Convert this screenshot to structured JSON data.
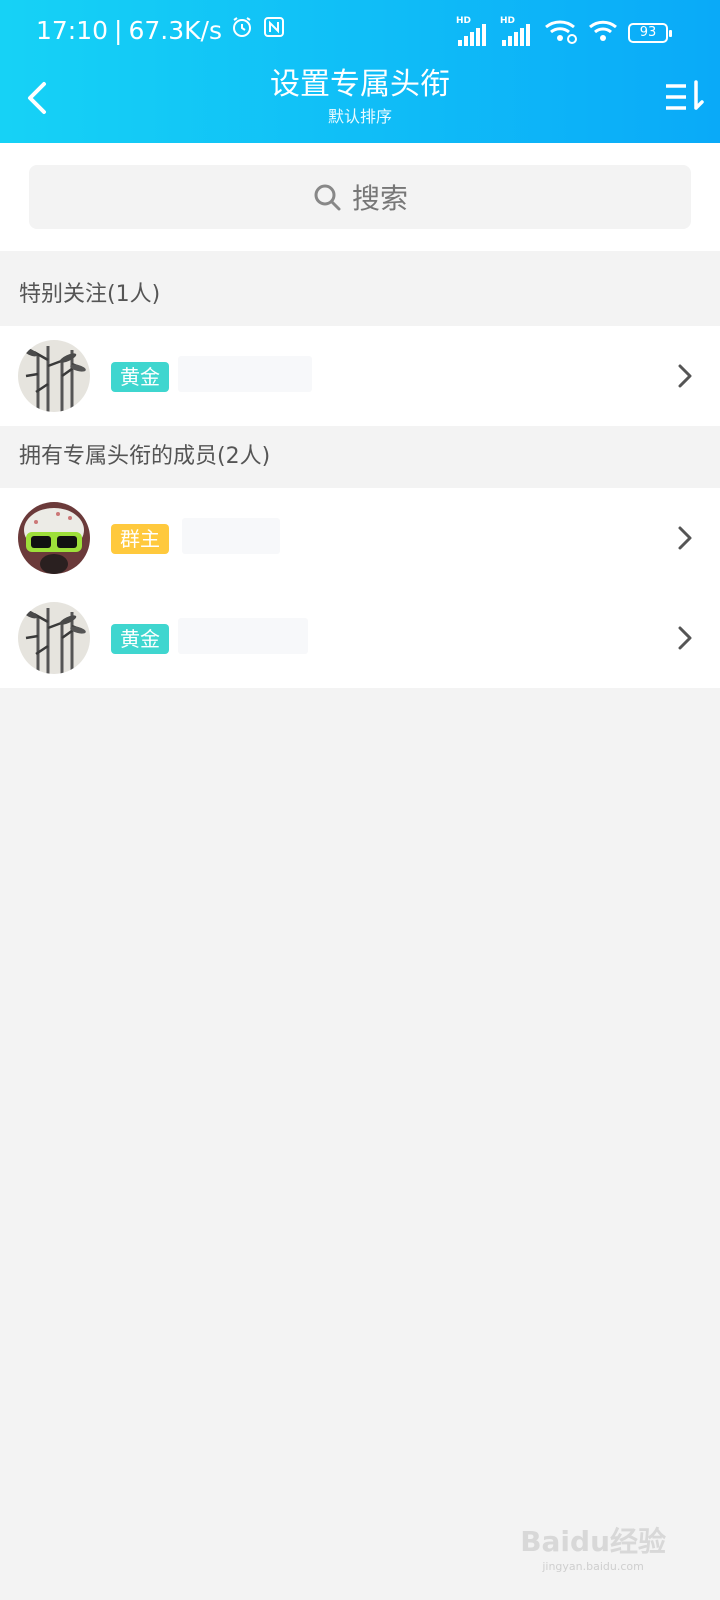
{
  "status_bar": {
    "time": "17:10",
    "speed": "67.3K/s",
    "battery": "93",
    "signal_label_1": "HD",
    "signal_label_2": "HD"
  },
  "header": {
    "title": "设置专属头衔",
    "subtitle": "默认排序"
  },
  "search": {
    "placeholder": "搜索"
  },
  "sections": [
    {
      "title": "特别关注(1人)",
      "members": [
        {
          "badge": "黄金",
          "badge_color": "#3fd6cf"
        }
      ]
    },
    {
      "title": "拥有专属头衔的成员(2人)",
      "members": [
        {
          "badge": "群主",
          "badge_color": "#ffc93d"
        },
        {
          "badge": "黄金",
          "badge_color": "#3fd6cf"
        }
      ]
    }
  ],
  "watermark": {
    "line1": "Baidu经验",
    "line2": "jingyan.baidu.com"
  },
  "colors": {
    "header_gradient_start": "#16d2f6",
    "header_gradient_end": "#0aaaf8",
    "background": "#f3f3f3"
  }
}
